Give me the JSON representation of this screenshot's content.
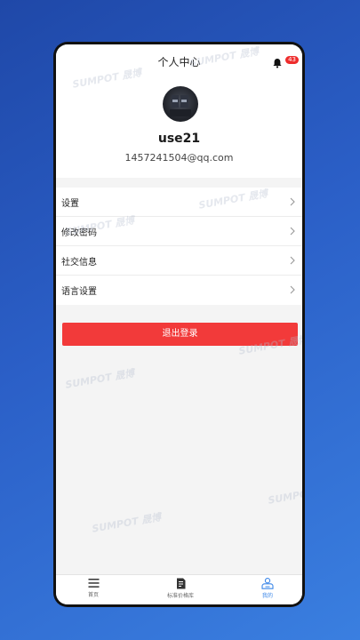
{
  "header": {
    "title": "个人中心",
    "notification_count": "43"
  },
  "profile": {
    "username": "use21",
    "email": "1457241504@qq.com"
  },
  "menu": {
    "items": [
      {
        "label": "设置"
      },
      {
        "label": "修改密码"
      },
      {
        "label": "社交信息"
      },
      {
        "label": "语言设置"
      }
    ]
  },
  "logout_label": "退出登录",
  "tabbar": {
    "tabs": [
      {
        "label": "首页",
        "icon": "menu-icon"
      },
      {
        "label": "标准价格库",
        "icon": "document-icon"
      },
      {
        "label": "我的",
        "icon": "user-icon",
        "active": true
      }
    ]
  },
  "watermark": "SUMPOT 晟博",
  "colors": {
    "accent_red": "#f23a3a",
    "active_tab_blue": "#3a86e8"
  }
}
